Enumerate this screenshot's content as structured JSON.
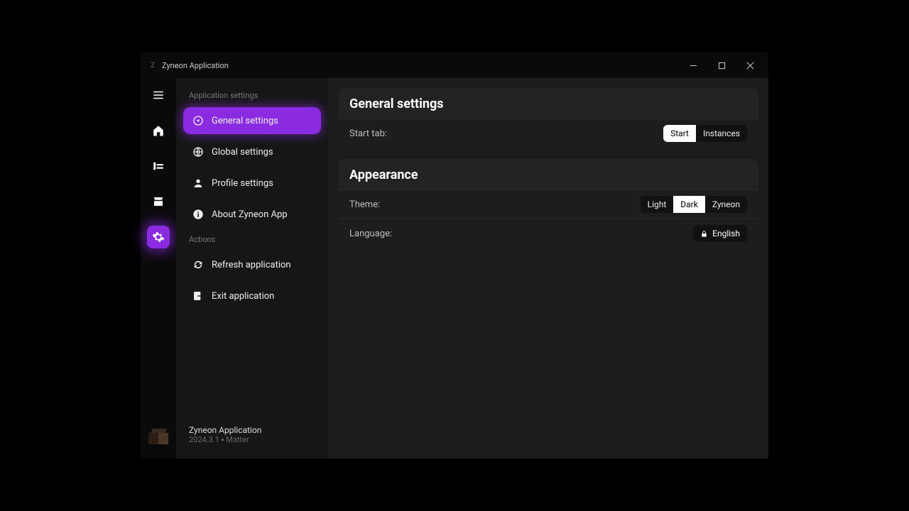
{
  "titlebar": {
    "title": "Zyneon Application"
  },
  "rail": {
    "items": [
      "menu",
      "home",
      "library",
      "store",
      "settings"
    ]
  },
  "sidebar": {
    "section1_title": "Application settings",
    "items": [
      {
        "label": "General settings"
      },
      {
        "label": "Global settings"
      },
      {
        "label": "Profile settings"
      },
      {
        "label": "About Zyneon App"
      }
    ],
    "section2_title": "Actions",
    "actions": [
      {
        "label": "Refresh application"
      },
      {
        "label": "Exit application"
      }
    ],
    "footer": {
      "name": "Zyneon Application",
      "version": "2024.3.1 ▪ Matter"
    }
  },
  "content": {
    "general": {
      "title": "General settings",
      "start_tab": {
        "label": "Start tab:",
        "options": [
          "Start",
          "Instances"
        ],
        "selected": "Start"
      }
    },
    "appearance": {
      "title": "Appearance",
      "theme": {
        "label": "Theme:",
        "options": [
          "Light",
          "Dark",
          "Zyneon"
        ],
        "selected": "Dark"
      },
      "language": {
        "label": "Language:",
        "value": "English"
      }
    }
  }
}
